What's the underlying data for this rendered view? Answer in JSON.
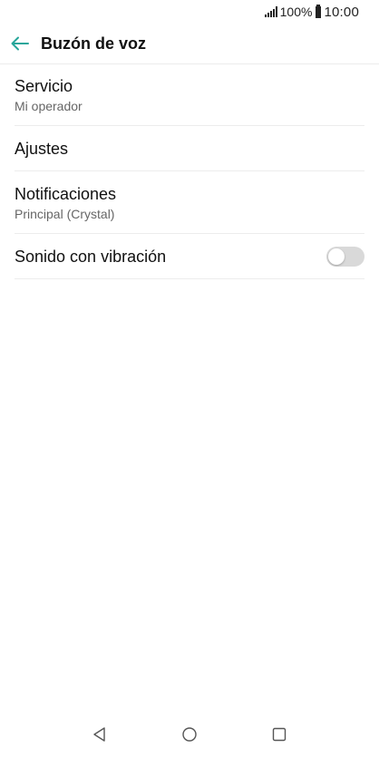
{
  "status_bar": {
    "battery_percent": "100%",
    "time": "10:00",
    "signal_icon": "signal-icon",
    "battery_icon": "battery-icon"
  },
  "app_bar": {
    "back_icon": "arrow-left-icon",
    "title": "Buzón de voz",
    "accent_color": "#26a69a"
  },
  "settings": [
    {
      "title": "Servicio",
      "summary": "Mi operador"
    },
    {
      "title": "Ajustes"
    },
    {
      "title": "Notificaciones",
      "summary": "Principal (Crystal)"
    },
    {
      "title": "Sonido con vibración",
      "toggle_on": false
    }
  ],
  "nav_bar": {
    "back": "triangle-back-icon",
    "home": "circle-home-icon",
    "recents": "square-recents-icon"
  }
}
